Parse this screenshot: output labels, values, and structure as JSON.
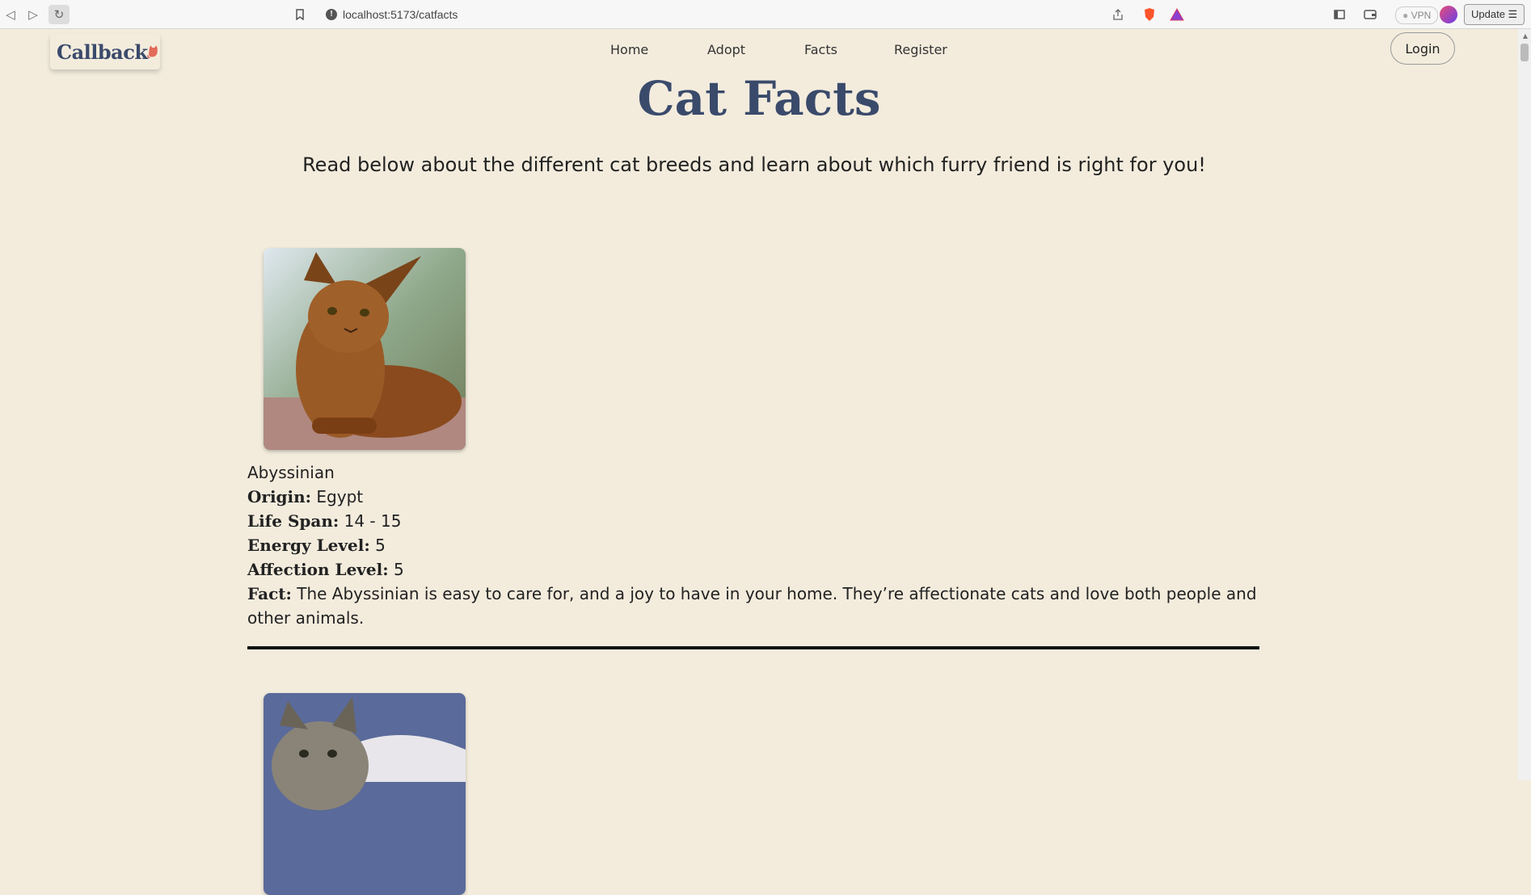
{
  "browser": {
    "url": "localhost:5173/catfacts",
    "vpn_label": "VPN",
    "update_label": "Update"
  },
  "site": {
    "logo_text": "Callback",
    "nav": [
      "Home",
      "Adopt",
      "Facts",
      "Register"
    ],
    "login_label": "Login"
  },
  "page": {
    "title": "Cat Facts",
    "subtitle": "Read below about the different cat breeds and learn about which furry friend is right for you!"
  },
  "cats": [
    {
      "name": "Abyssinian",
      "origin_label": "Origin:",
      "origin": "Egypt",
      "lifespan_label": "Life Span:",
      "lifespan": "14 - 15",
      "energy_label": "Energy Level:",
      "energy": "5",
      "affection_label": "Affection Level:",
      "affection": "5",
      "fact_label": "Fact:",
      "fact": "The Abyssinian is easy to care for, and a joy to have in your home. They’re affectionate cats and love both people and other animals."
    }
  ]
}
